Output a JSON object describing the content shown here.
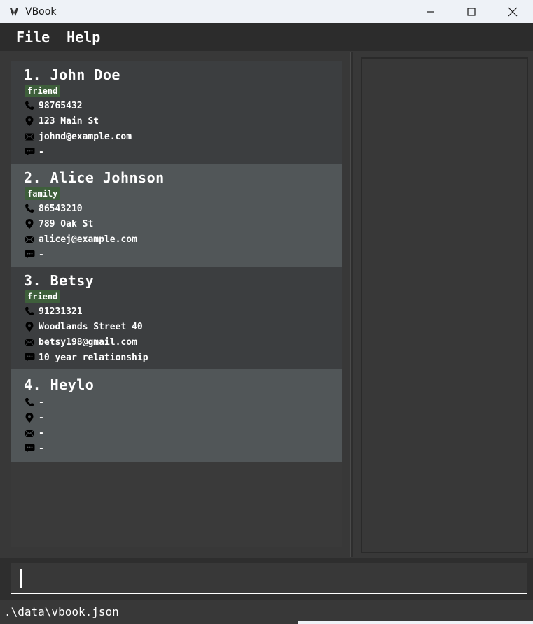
{
  "window": {
    "title": "VBook",
    "controls": [
      "minimize-icon",
      "maximize-icon",
      "close-icon"
    ]
  },
  "menu": {
    "items": [
      {
        "label": "File"
      },
      {
        "label": "Help"
      }
    ]
  },
  "persons": [
    {
      "index_name": "1. John Doe",
      "tag": "friend",
      "phone": "98765432",
      "address": "123 Main St",
      "email": "johnd@example.com",
      "remark": "-"
    },
    {
      "index_name": "2. Alice Johnson",
      "tag": "family",
      "phone": "86543210",
      "address": "789 Oak St",
      "email": "alicej@example.com",
      "remark": "-"
    },
    {
      "index_name": "3. Betsy",
      "tag": "friend",
      "phone": "91231321",
      "address": "Woodlands Street 40",
      "email": "betsy198@gmail.com",
      "remark": "10 year relationship"
    },
    {
      "index_name": "4. Heylo",
      "tag": "",
      "phone": "-",
      "address": "-",
      "email": "-",
      "remark": "-"
    }
  ],
  "command": {
    "value": "",
    "placeholder": ""
  },
  "status": {
    "path": ".\\data\\vbook.json"
  },
  "colors": {
    "background": "#383838",
    "card_dark": "#3c3e40",
    "card_light": "#515658",
    "tag": "#3e5f3b",
    "titlebar": "#eef2f7"
  },
  "icons": {
    "phone": "phone-icon",
    "address": "location-pin-icon",
    "email": "envelope-icon",
    "remark": "speech-bubble-icon"
  }
}
